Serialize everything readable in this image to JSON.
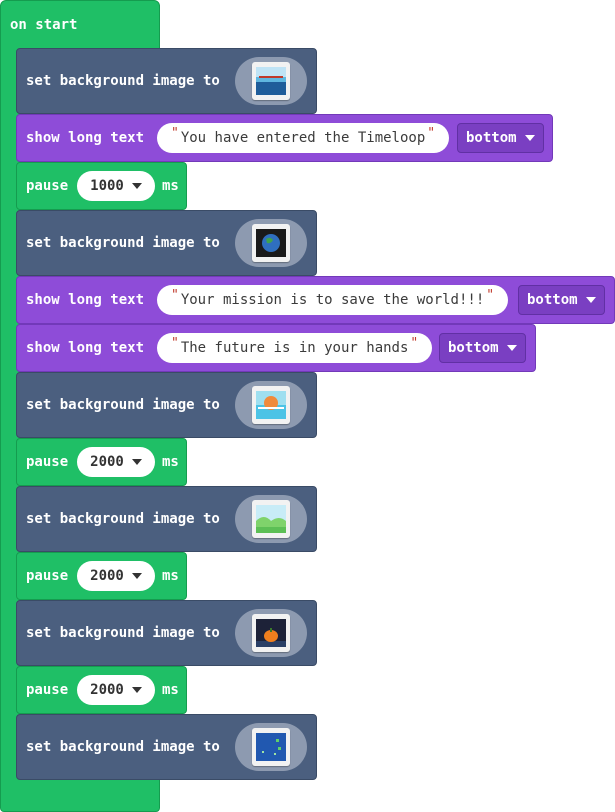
{
  "event": {
    "label": "on start"
  },
  "labels": {
    "set_background": "set background image to",
    "show_long_text": "show long text",
    "pause": "pause",
    "ms": "ms"
  },
  "blocks": {
    "b1": {
      "image": "ocean-bridge-image"
    },
    "b2": {
      "text": "You have entered the Timeloop",
      "position": "bottom"
    },
    "b3": {
      "value": "1000"
    },
    "b4": {
      "image": "earth-image"
    },
    "b5": {
      "text": "Your mission is to save the world!!!",
      "position": "bottom"
    },
    "b6": {
      "text": "The future is in your hands",
      "position": "bottom"
    },
    "b7": {
      "image": "sunset-sea-image"
    },
    "b8": {
      "value": "2000"
    },
    "b9": {
      "image": "green-landscape-image"
    },
    "b10": {
      "value": "2000"
    },
    "b11": {
      "image": "pumpkin-night-image"
    },
    "b12": {
      "value": "2000"
    },
    "b13": {
      "image": "blue-map-image"
    }
  },
  "colors": {
    "event_green": "#1fbf66",
    "scene_slate": "#4b5f7f",
    "text_purple": "#8e4cd8",
    "string_quote_red": "#c0392b"
  }
}
